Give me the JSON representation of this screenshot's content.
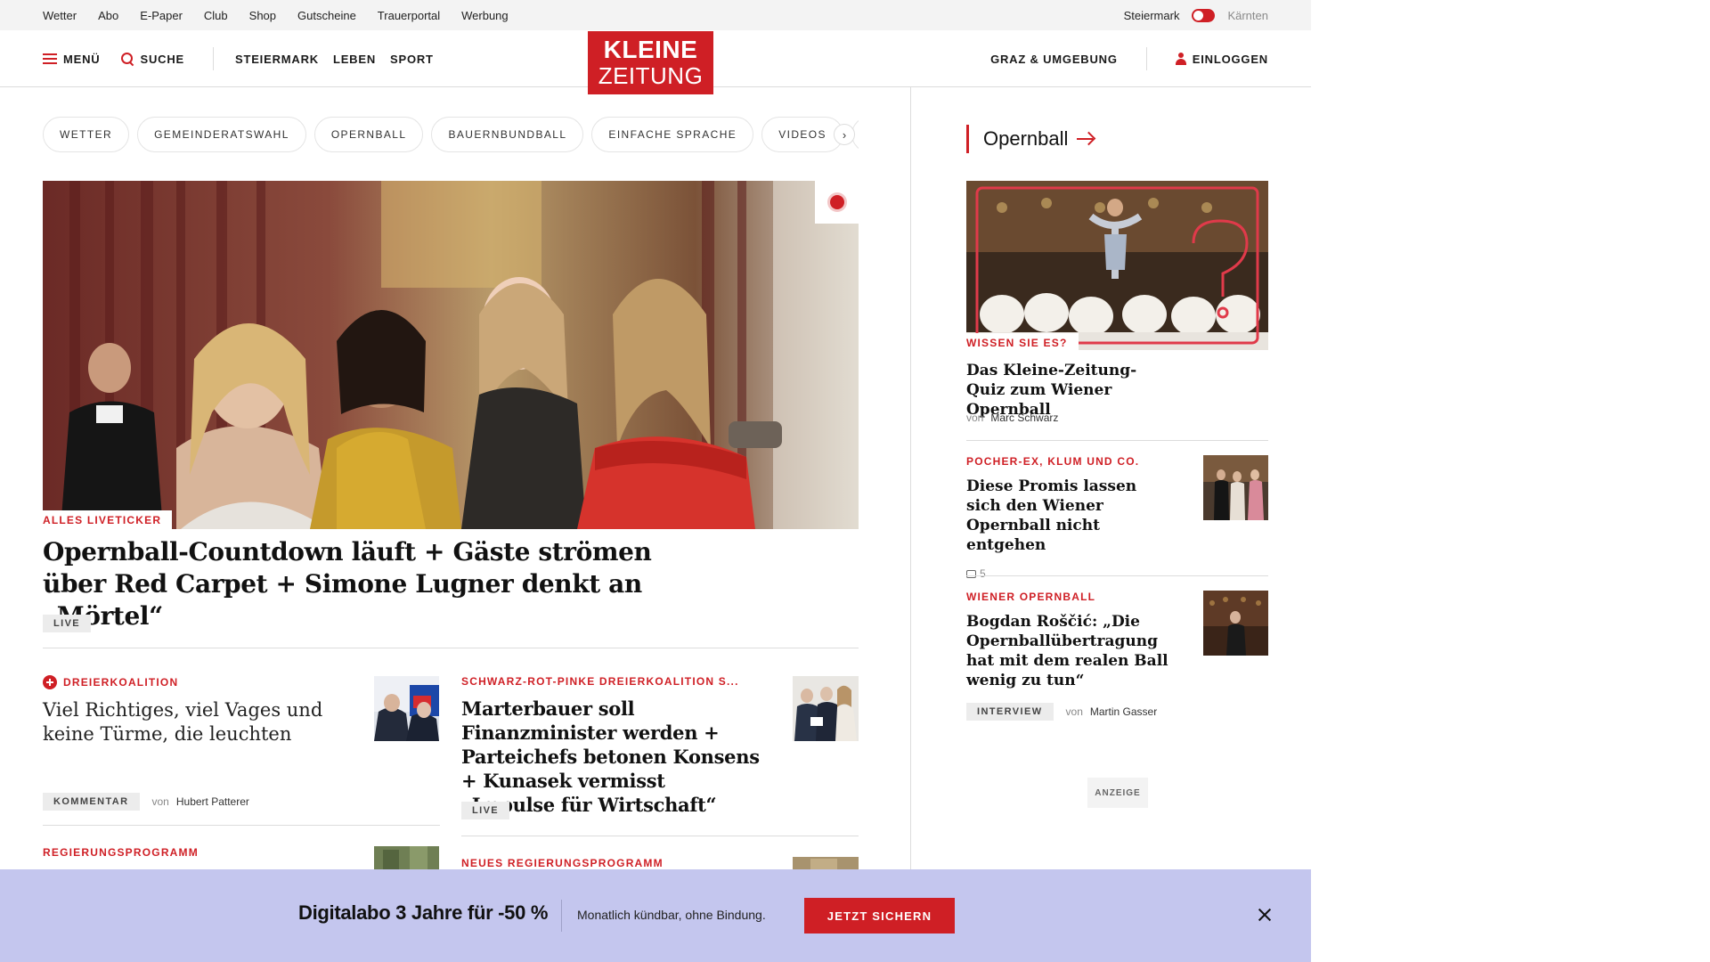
{
  "utility_bar": {
    "links": [
      "Wetter",
      "Abo",
      "E-Paper",
      "Club",
      "Shop",
      "Gutscheine",
      "Trauerportal",
      "Werbung"
    ],
    "region_active": "Steiermark",
    "region_inactive": "Kärnten"
  },
  "header": {
    "menu_label": "MENÜ",
    "search_label": "SUCHE",
    "sections": [
      "STEIERMARK",
      "LEBEN",
      "SPORT"
    ],
    "logo_line1": "KLEINE",
    "logo_line2": "ZEITUNG",
    "local_label": "GRAZ & UMGEBUNG",
    "login_label": "EINLOGGEN"
  },
  "tags": [
    "WETTER",
    "GEMEINDERATSWAHL",
    "OPERNBALL",
    "BAUERNBUNDBALL",
    "EINFACHE SPRACHE",
    "VIDEOS",
    "K"
  ],
  "hero": {
    "kicker": "ALLES LIVETICKER",
    "title": "Opernball-Countdown läuft + Gäste strömen über Red Carpet + Simone Lugner denkt an „Mörtel“",
    "badge": "LIVE"
  },
  "teasers": [
    {
      "kicker": "DREIERKOALITION",
      "title": "Viel Richtiges, viel Vages und keine Türme, die leuchten",
      "badge": "KOMMENTAR",
      "by_prefix": "von",
      "author": "Hubert Patterer"
    },
    {
      "kicker": "SCHWARZ-ROT-PINKE DREIERKOALITION S...",
      "title": "Marterbauer soll Finanzminister werden + Parteichefs betonen Konsens + Kunasek vermisst „Impulse für Wirtschaft“",
      "badge": "LIVE"
    },
    {
      "kicker": "REGIERUNGSPROGRAMM"
    },
    {
      "kicker": "NEUES REGIERUNGSPROGRAMM"
    }
  ],
  "sidebar": {
    "heading": "Opernball",
    "lead": {
      "kicker": "WISSEN SIE ES?",
      "title": "Das Kleine-Zeitung-Quiz zum Wiener Opernball",
      "by_prefix": "von",
      "author": "Marc Schwarz"
    },
    "items": [
      {
        "kicker": "POCHER-EX, KLUM UND CO.",
        "title": "Diese Promis lassen sich den Wiener Opernball nicht entgehen",
        "comments": "5"
      },
      {
        "kicker": "WIENER OPERNBALL",
        "title": "Bogdan Roščić: „Die Opernballübertragung hat mit dem realen Ball wenig zu tun“",
        "badge": "INTERVIEW",
        "by_prefix": "von",
        "author": "Martin Gasser"
      }
    ],
    "ad_label": "ANZEIGE"
  },
  "promo": {
    "title": "Digitalabo 3 Jahre für -50 %",
    "subtitle": "Monatlich kündbar, ohne Bindung.",
    "cta": "JETZT SICHERN"
  },
  "colors": {
    "brand_red": "#cf1f25",
    "promo_bg": "#c4c6ee",
    "utility_bg": "#f3f3f3"
  }
}
